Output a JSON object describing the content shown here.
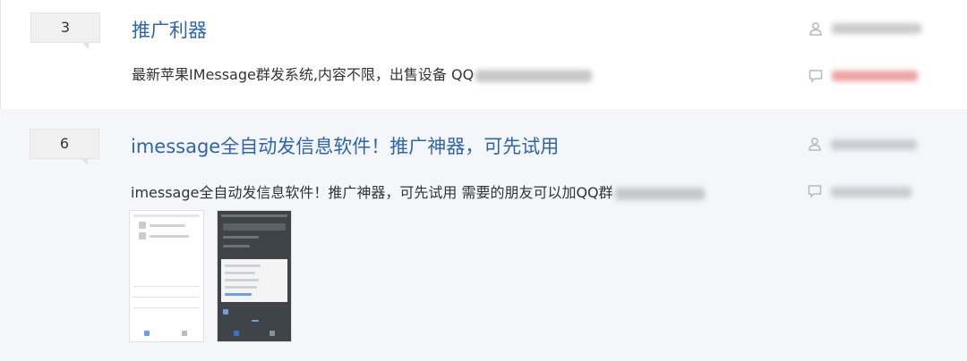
{
  "posts": [
    {
      "count": "3",
      "title": "推广利器",
      "snippet": "最新苹果IMessage群发系统,内容不限，出售设备 QQ"
    },
    {
      "count": "6",
      "title": "imessage全自动发信息软件！推广神器，可先试用",
      "snippet": "imessage全自动发信息软件！推广神器，可先试用 需要的朋友可以加QQ群"
    }
  ],
  "icons": {
    "author": "user-icon",
    "reply": "comment-icon"
  },
  "colors": {
    "title_link": "#2d64b3",
    "highlight_bg": "#f4f6fa",
    "reply_name_red": "#e85c5c"
  }
}
